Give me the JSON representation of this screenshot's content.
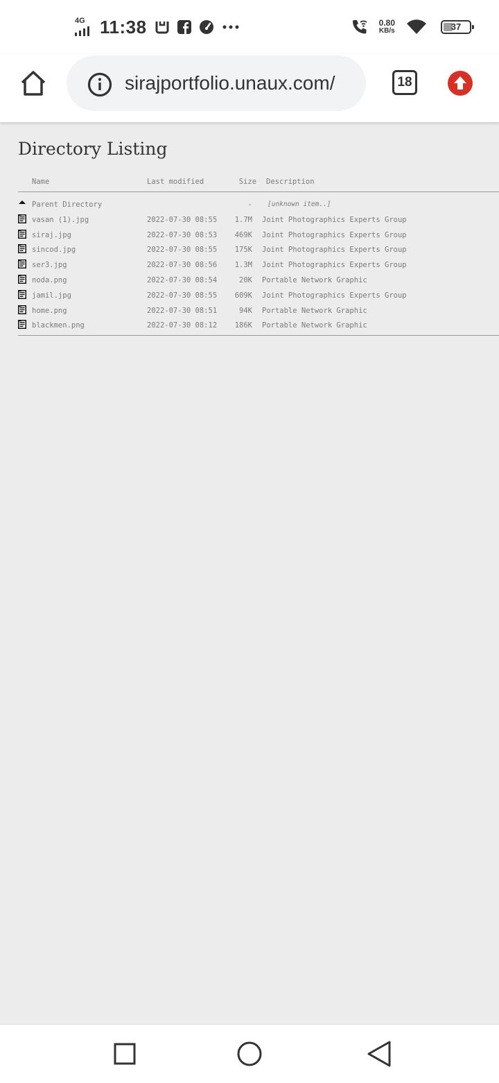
{
  "status_bar": {
    "network": "4G",
    "time": "11:38",
    "speed_value": "0.80",
    "speed_unit": "KB/s",
    "battery": "37",
    "battery_level": 0.37,
    "icons": [
      "signal-icon",
      "notification-box-icon",
      "facebook-icon",
      "speedometer-icon",
      "more-dots-icon",
      "wifi-calling-icon",
      "wifi-icon",
      "battery-icon"
    ]
  },
  "browser": {
    "url": "sirajportfolio.unaux.com/",
    "tab_count": "18",
    "accent_color": "#d93025"
  },
  "page": {
    "title": "Directory Listing",
    "columns": {
      "name": "Name",
      "modified": "Last modified",
      "size": "Size",
      "description": "Description"
    },
    "parent": {
      "name": "Parent Directory",
      "size": "-",
      "description": "[unknown item..]"
    },
    "files": [
      {
        "name": "vasan (1).jpg",
        "modified": "2022-07-30 08:55",
        "size": "1.7M",
        "description": "Joint Photographics Experts Group"
      },
      {
        "name": "siraj.jpg",
        "modified": "2022-07-30 08:53",
        "size": "469K",
        "description": "Joint Photographics Experts Group"
      },
      {
        "name": "sincod.jpg",
        "modified": "2022-07-30 08:55",
        "size": "175K",
        "description": "Joint Photographics Experts Group"
      },
      {
        "name": "ser3.jpg",
        "modified": "2022-07-30 08:56",
        "size": "1.3M",
        "description": "Joint Photographics Experts Group"
      },
      {
        "name": "noda.png",
        "modified": "2022-07-30 08:54",
        "size": "20K",
        "description": "Portable Network Graphic"
      },
      {
        "name": "jamil.jpg",
        "modified": "2022-07-30 08:55",
        "size": "609K",
        "description": "Joint Photographics Experts Group"
      },
      {
        "name": "home.png",
        "modified": "2022-07-30 08:51",
        "size": "94K",
        "description": "Portable Network Graphic"
      },
      {
        "name": "blackmen.png",
        "modified": "2022-07-30 08:12",
        "size": "186K",
        "description": "Portable Network Graphic"
      }
    ]
  },
  "nav": {
    "icons": [
      "recents-square-icon",
      "home-circle-icon",
      "back-triangle-icon"
    ]
  }
}
